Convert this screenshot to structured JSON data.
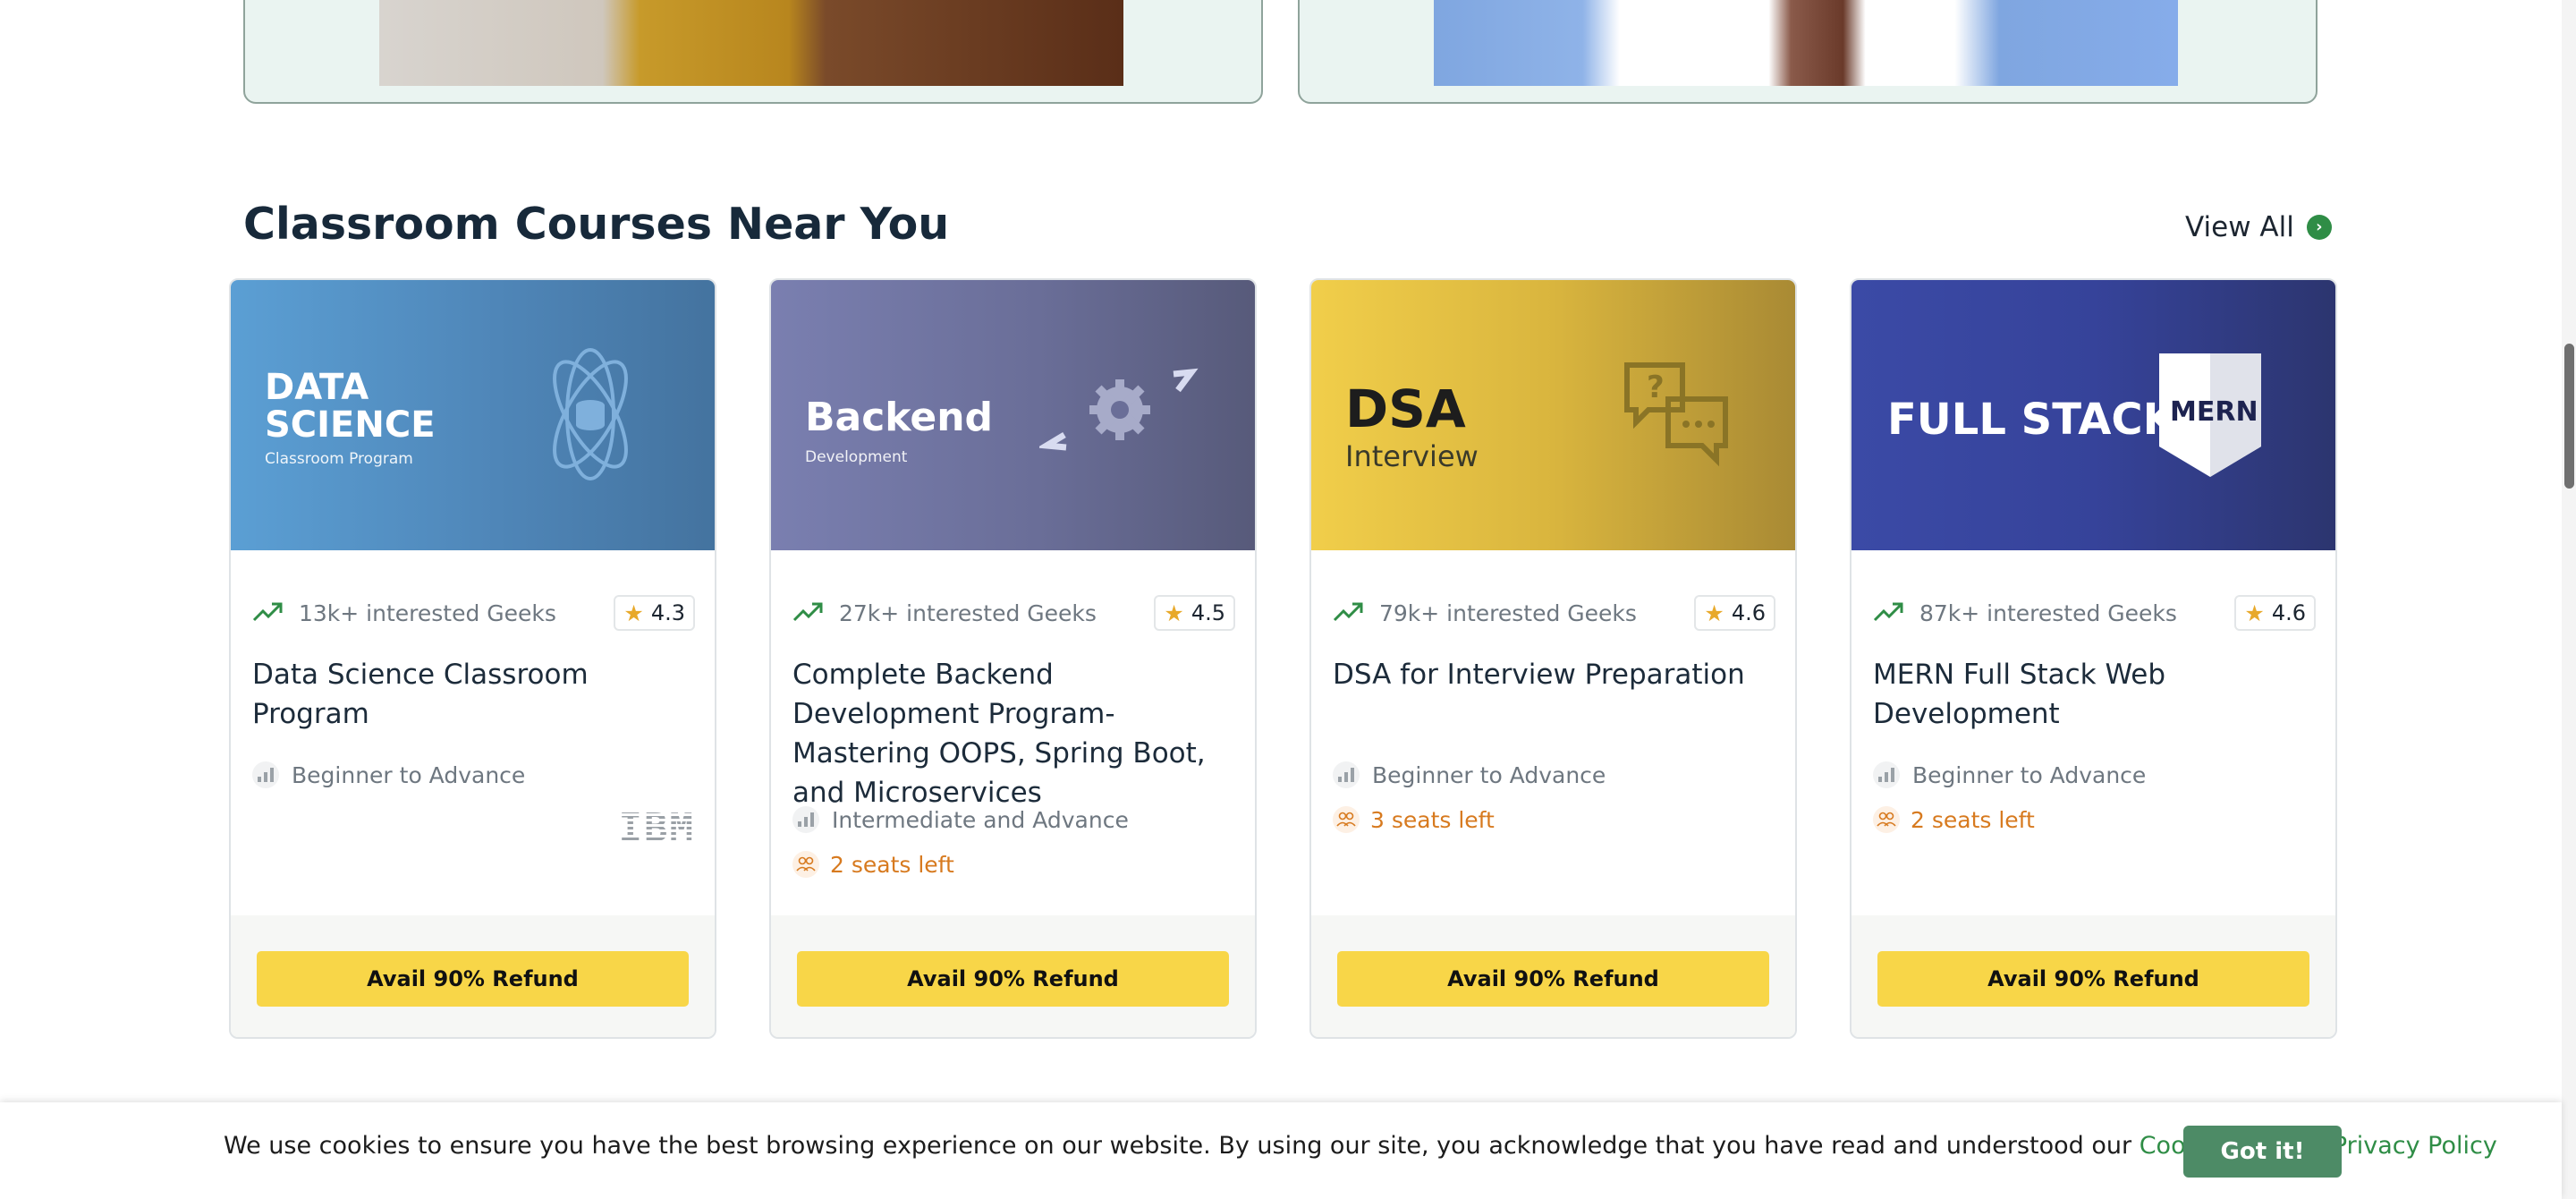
{
  "section": {
    "title": "Classroom Courses Near You",
    "view_all": "View All"
  },
  "courses": [
    {
      "banner": {
        "line1": "DATA",
        "line2": "SCIENCE",
        "sub": "Classroom Program"
      },
      "interested": "13k+ interested Geeks",
      "rating": "4.3",
      "title": "Data Science Classroom Program",
      "level": "Beginner to Advance",
      "seats": "",
      "partner_logo": "IBM",
      "cta": "Avail 90% Refund"
    },
    {
      "banner": {
        "line1": "Backend",
        "sub": "Development"
      },
      "interested": "27k+ interested Geeks",
      "rating": "4.5",
      "title": "Complete Backend Development Program- Mastering OOPS, Spring Boot, and Microservices",
      "level": "Intermediate and Advance",
      "seats": "2 seats left",
      "cta": "Avail 90% Refund"
    },
    {
      "banner": {
        "line1": "DSA",
        "sub": "Interview"
      },
      "interested": "79k+ interested Geeks",
      "rating": "4.6",
      "title": "DSA for Interview Preparation",
      "level": "Beginner to Advance",
      "seats": "3 seats left",
      "cta": "Avail 90% Refund"
    },
    {
      "banner": {
        "line1": "FULL STACK",
        "badge": "MERN"
      },
      "interested": "87k+ interested Geeks",
      "rating": "4.6",
      "title": "MERN Full Stack Web Development",
      "level": "Beginner to Advance",
      "seats": "2 seats left",
      "cta": "Avail 90% Refund"
    }
  ],
  "cookie": {
    "text": "We use cookies to ensure you have the best browsing experience on our website. By using our site, you acknowledge that you have read and understood our",
    "cookie_policy": "Cookie Policy",
    "amp": "&",
    "privacy_policy": "Privacy Policy",
    "button": "Got it!"
  },
  "colors": {
    "accent_green": "#2f8d46",
    "cta_yellow": "#f8d648",
    "seats_orange": "#d77a1f",
    "cookie_button": "#4d8b66"
  },
  "icons": [
    "trending-up-icon",
    "star-icon",
    "level-bars-icon",
    "users-icon",
    "chevron-right-icon",
    "atom-icon",
    "gear-icon",
    "chat-question-icon",
    "mern-shield-icon"
  ]
}
